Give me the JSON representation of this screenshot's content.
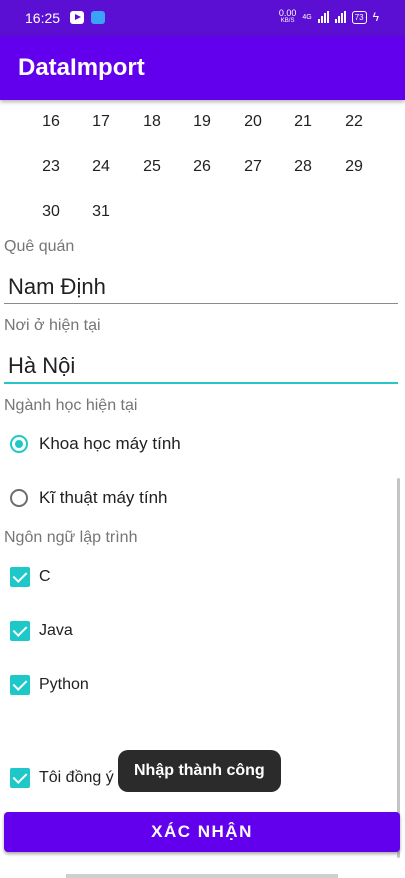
{
  "status_bar": {
    "time": "16:25",
    "net_speed": "0.00",
    "net_unit": "KB/S",
    "network_type": "4G",
    "battery": "73",
    "icons": [
      "youtube-icon",
      "messenger-icon",
      "signal-icon",
      "battery-icon",
      "charging-icon"
    ]
  },
  "app_bar": {
    "title": "DataImport"
  },
  "calendar": {
    "rows": [
      [
        "16",
        "17",
        "18",
        "19",
        "20",
        "21",
        "22"
      ],
      [
        "23",
        "24",
        "25",
        "26",
        "27",
        "28",
        "29"
      ],
      [
        "30",
        "31"
      ]
    ]
  },
  "hometown": {
    "label": "Quê quán",
    "value": "Nam Định"
  },
  "residence": {
    "label": "Nơi ở hiện tại",
    "value": "Hà Nội"
  },
  "major": {
    "label": "Ngành học hiện tại",
    "options": [
      {
        "label": "Khoa học máy tính",
        "selected": true
      },
      {
        "label": "Kĩ thuật máy tính",
        "selected": false
      }
    ]
  },
  "languages": {
    "label": "Ngôn ngữ lập trình",
    "options": [
      {
        "label": "C",
        "checked": true
      },
      {
        "label": "Java",
        "checked": true
      },
      {
        "label": "Python",
        "checked": true
      }
    ]
  },
  "agree": {
    "label": "Tôi đồng ý",
    "checked": true
  },
  "toast": {
    "text": "Nhập thành công"
  },
  "confirm_button": {
    "label": "XÁC NHẬN"
  },
  "colors": {
    "primary": "#6200ee",
    "status_bar": "#5b0fd3",
    "accent": "#1ec8c8"
  }
}
